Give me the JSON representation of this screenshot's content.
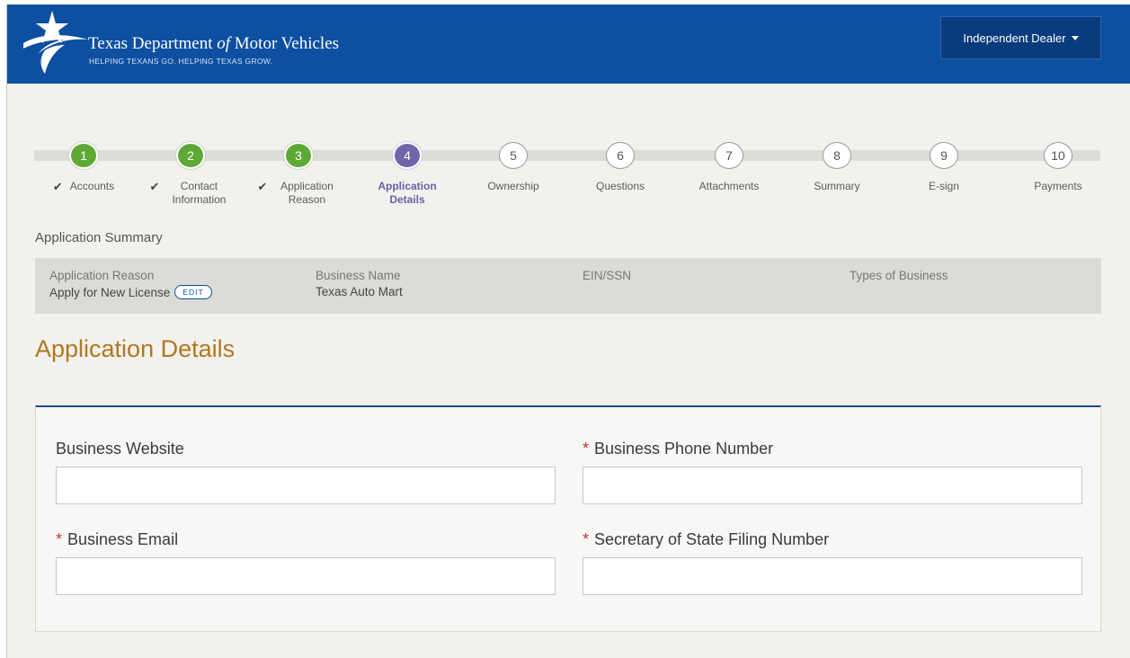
{
  "header": {
    "brand_title_prefix": "Texas Department",
    "brand_title_of": "of",
    "brand_title_suffix": "Motor Vehicles",
    "tagline": "HELPING TEXANS GO. HELPING TEXAS GROW.",
    "role_menu_label": "Independent Dealer",
    "logo_icon": "texas-star-swoosh-icon",
    "color_header": "#0d4fa0"
  },
  "stepper": {
    "steps": [
      {
        "number": "1",
        "label": "Accounts",
        "state": "done"
      },
      {
        "number": "2",
        "label": "Contact Information",
        "state": "done"
      },
      {
        "number": "3",
        "label": "Application Reason",
        "state": "done"
      },
      {
        "number": "4",
        "label": "Application Details",
        "state": "active"
      },
      {
        "number": "5",
        "label": "Ownership",
        "state": "pending"
      },
      {
        "number": "6",
        "label": "Questions",
        "state": "pending"
      },
      {
        "number": "7",
        "label": "Attachments",
        "state": "pending"
      },
      {
        "number": "8",
        "label": "Summary",
        "state": "pending"
      },
      {
        "number": "9",
        "label": "E-sign",
        "state": "pending"
      },
      {
        "number": "10",
        "label": "Payments",
        "state": "pending"
      }
    ],
    "check_glyph": "✔",
    "color_done": "#5ea935",
    "color_active": "#7066a7"
  },
  "summary": {
    "title": "Application Summary",
    "columns": [
      {
        "label": "Application Reason",
        "value": "Apply for New License",
        "action": "EDIT"
      },
      {
        "label": "Business Name",
        "value": "Texas Auto Mart"
      },
      {
        "label": "EIN/SSN",
        "value": ""
      },
      {
        "label": "Types of Business",
        "value": ""
      }
    ]
  },
  "page": {
    "title": "Application Details",
    "title_color": "#b07820"
  },
  "form": {
    "required_marker": "*",
    "fields": [
      {
        "label": "Business Website",
        "required": false,
        "value": ""
      },
      {
        "label": "Business Phone Number",
        "required": true,
        "value": ""
      },
      {
        "label": "Business Email",
        "required": true,
        "value": ""
      },
      {
        "label": "Secretary of State Filing Number",
        "required": true,
        "value": ""
      }
    ]
  }
}
